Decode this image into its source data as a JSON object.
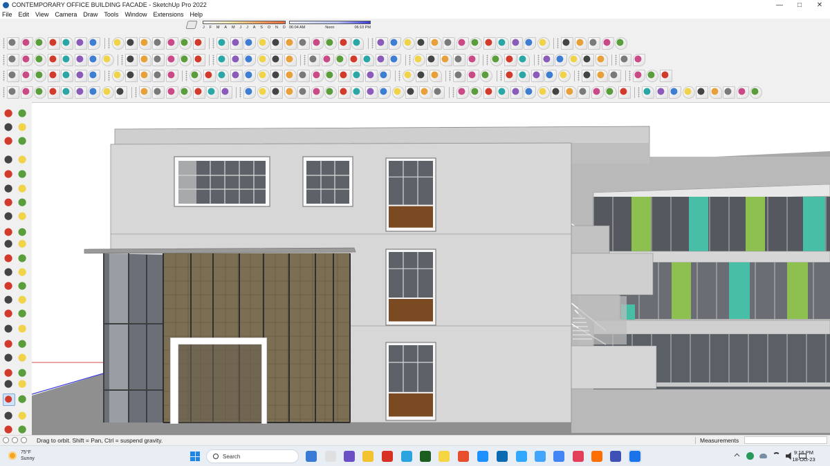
{
  "window": {
    "title": "CONTEMPORARY OFFICE BUILDING FACADE - SketchUp Pro 2022",
    "minimize_icon": "minimize-icon",
    "maximize_icon": "maximize-icon",
    "close_icon": "close-icon"
  },
  "menu": [
    "File",
    "Edit",
    "View",
    "Camera",
    "Draw",
    "Tools",
    "Window",
    "Extensions",
    "Help"
  ],
  "shadow_settings": {
    "months": [
      "J",
      "F",
      "M",
      "A",
      "M",
      "J",
      "J",
      "A",
      "S",
      "O",
      "N",
      "D"
    ],
    "times": [
      "06:04 AM",
      "Noon",
      "06:10 PM"
    ]
  },
  "status": {
    "hint": "Drag to orbit. Shift = Pan, Ctrl = suspend gravity.",
    "measurements_label": "Measurements",
    "measurements_value": ""
  },
  "taskbar": {
    "weather_temp": "75°F",
    "weather_desc": "Sunny",
    "search_label": "Search",
    "time": "9:16 PM",
    "date": "18-Oct-23"
  },
  "colors": {
    "wall_light": "#d6d6d6",
    "wall_mid": "#c3c3c3",
    "glass": "#5c6068",
    "timber": "#7a4b22",
    "cladding": "#7d6d4f",
    "green_panel": "#8cc24a",
    "teal_panel": "#3fbf9f"
  }
}
